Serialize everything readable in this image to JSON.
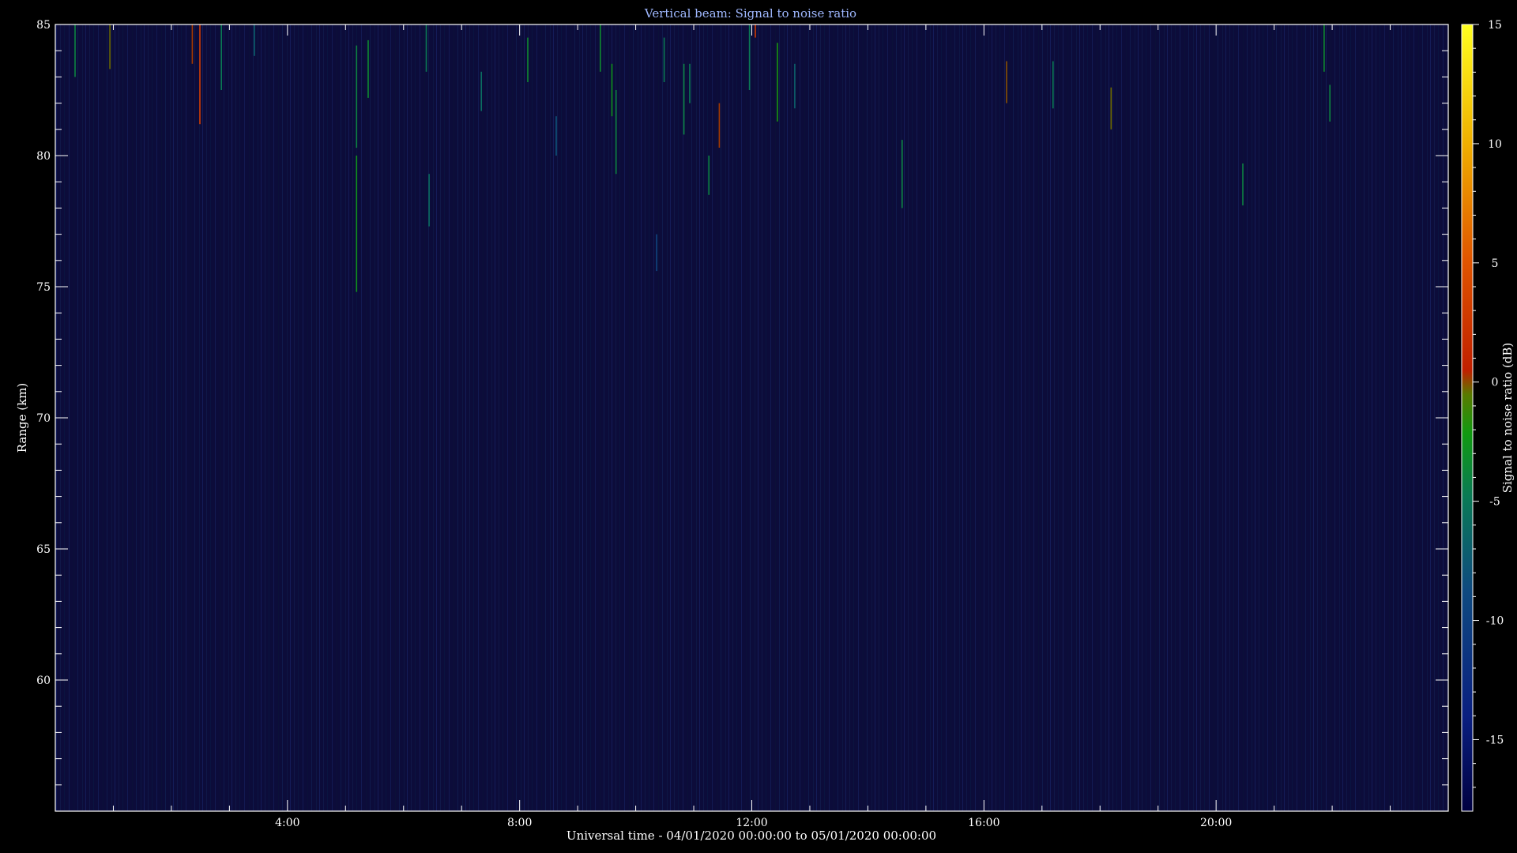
{
  "chart_data": {
    "type": "heatmap",
    "title": "Vertical beam: Signal to noise ratio",
    "xlabel": "Universal time - 04/01/2020 00:00:00 to 05/01/2020 00:00:00",
    "ylabel": "Range (km)",
    "colorbar_label": "Signal to noise ratio (dB)",
    "xlim": [
      0,
      24
    ],
    "ylim": [
      55,
      85
    ],
    "clim": [
      -18,
      15
    ],
    "x_ticks": [
      {
        "value": 4,
        "label": "4:00"
      },
      {
        "value": 8,
        "label": "8:00"
      },
      {
        "value": 12,
        "label": "12:00"
      },
      {
        "value": 16,
        "label": "16:00"
      },
      {
        "value": 20,
        "label": "20:00"
      }
    ],
    "y_ticks": [
      {
        "value": 60,
        "label": "60"
      },
      {
        "value": 65,
        "label": "65"
      },
      {
        "value": 70,
        "label": "70"
      },
      {
        "value": 75,
        "label": "75"
      },
      {
        "value": 80,
        "label": "80"
      },
      {
        "value": 85,
        "label": "85"
      }
    ],
    "colorbar_ticks": [
      {
        "value": -15,
        "label": "-15"
      },
      {
        "value": -10,
        "label": "-10"
      },
      {
        "value": -5,
        "label": "-5"
      },
      {
        "value": 0,
        "label": "0"
      },
      {
        "value": 5,
        "label": "5"
      },
      {
        "value": 10,
        "label": "10"
      },
      {
        "value": 15,
        "label": "15"
      }
    ],
    "background_snr": -17,
    "colormap": [
      "#000040",
      "#0a1f80",
      "#0f4a80",
      "#0a7a55",
      "#119a11",
      "#5a7a00",
      "#c02000",
      "#e05500",
      "#f0b000",
      "#ffff20"
    ],
    "echoes": [
      {
        "t": 0.33,
        "r0": 83.0,
        "r1": 85.0,
        "snr": -6
      },
      {
        "t": 0.93,
        "r0": 83.3,
        "r1": 85.0,
        "snr": 1
      },
      {
        "t": 2.35,
        "r0": 83.5,
        "r1": 85.0,
        "snr": 3
      },
      {
        "t": 2.48,
        "r0": 81.2,
        "r1": 85.0,
        "snr": 6
      },
      {
        "t": 2.85,
        "r0": 82.5,
        "r1": 85.0,
        "snr": -7
      },
      {
        "t": 3.42,
        "r0": 83.8,
        "r1": 85.0,
        "snr": -9
      },
      {
        "t": 5.18,
        "r0": 74.8,
        "r1": 80.0,
        "snr": -4
      },
      {
        "t": 5.18,
        "r0": 80.3,
        "r1": 84.2,
        "snr": -6
      },
      {
        "t": 5.38,
        "r0": 82.2,
        "r1": 84.4,
        "snr": -5
      },
      {
        "t": 6.38,
        "r0": 83.2,
        "r1": 85.0,
        "snr": -7
      },
      {
        "t": 6.43,
        "r0": 77.3,
        "r1": 79.3,
        "snr": -8
      },
      {
        "t": 7.33,
        "r0": 81.7,
        "r1": 83.2,
        "snr": -8
      },
      {
        "t": 8.13,
        "r0": 82.8,
        "r1": 84.5,
        "snr": -5
      },
      {
        "t": 8.62,
        "r0": 80.0,
        "r1": 81.5,
        "snr": -10
      },
      {
        "t": 9.38,
        "r0": 83.2,
        "r1": 85.0,
        "snr": -5
      },
      {
        "t": 9.58,
        "r0": 81.5,
        "r1": 83.5,
        "snr": -4
      },
      {
        "t": 9.65,
        "r0": 79.3,
        "r1": 82.5,
        "snr": -6
      },
      {
        "t": 10.35,
        "r0": 75.6,
        "r1": 77.0,
        "snr": -11
      },
      {
        "t": 10.48,
        "r0": 82.8,
        "r1": 84.5,
        "snr": -7
      },
      {
        "t": 10.82,
        "r0": 80.8,
        "r1": 83.5,
        "snr": -6
      },
      {
        "t": 10.92,
        "r0": 82.0,
        "r1": 83.5,
        "snr": -7
      },
      {
        "t": 11.25,
        "r0": 78.5,
        "r1": 80.0,
        "snr": -6
      },
      {
        "t": 11.43,
        "r0": 80.3,
        "r1": 82.0,
        "snr": 3
      },
      {
        "t": 11.95,
        "r0": 82.5,
        "r1": 85.0,
        "snr": -7
      },
      {
        "t": 12.05,
        "r0": 84.5,
        "r1": 85.0,
        "snr": 6
      },
      {
        "t": 12.43,
        "r0": 81.3,
        "r1": 84.3,
        "snr": -3
      },
      {
        "t": 12.73,
        "r0": 81.8,
        "r1": 83.5,
        "snr": -9
      },
      {
        "t": 14.58,
        "r0": 78.0,
        "r1": 80.6,
        "snr": -6
      },
      {
        "t": 16.38,
        "r0": 82.0,
        "r1": 83.6,
        "snr": 2
      },
      {
        "t": 17.18,
        "r0": 81.8,
        "r1": 83.6,
        "snr": -7
      },
      {
        "t": 18.18,
        "r0": 81.0,
        "r1": 82.6,
        "snr": 1
      },
      {
        "t": 20.45,
        "r0": 78.1,
        "r1": 79.7,
        "snr": -6
      },
      {
        "t": 21.85,
        "r0": 83.2,
        "r1": 85.0,
        "snr": -5
      },
      {
        "t": 21.95,
        "r0": 81.3,
        "r1": 82.7,
        "snr": -6
      }
    ]
  }
}
